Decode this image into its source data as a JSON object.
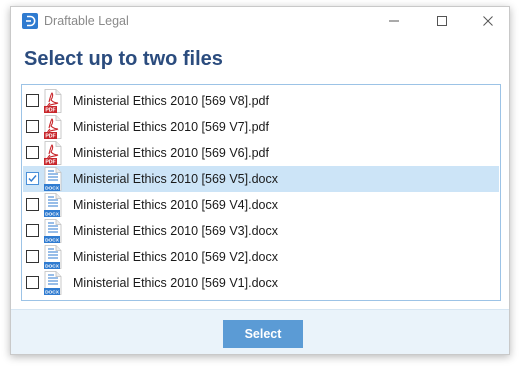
{
  "window": {
    "title": "Draftable Legal",
    "controls": {
      "minimize_icon": "minimize-icon",
      "maximize_icon": "maximize-icon",
      "close_icon": "close-icon"
    }
  },
  "heading": "Select up to two files",
  "files": [
    {
      "name": "Ministerial Ethics 2010 [569 V8].pdf",
      "type": "pdf",
      "checked": false,
      "selected": false
    },
    {
      "name": "Ministerial Ethics 2010 [569 V7].pdf",
      "type": "pdf",
      "checked": false,
      "selected": false
    },
    {
      "name": "Ministerial Ethics 2010 [569 V6].pdf",
      "type": "pdf",
      "checked": false,
      "selected": false
    },
    {
      "name": "Ministerial Ethics 2010 [569 V5].docx",
      "type": "docx",
      "checked": true,
      "selected": true
    },
    {
      "name": "Ministerial Ethics 2010 [569 V4].docx",
      "type": "docx",
      "checked": false,
      "selected": false
    },
    {
      "name": "Ministerial Ethics 2010 [569 V3].docx",
      "type": "docx",
      "checked": false,
      "selected": false
    },
    {
      "name": "Ministerial Ethics 2010 [569 V2].docx",
      "type": "docx",
      "checked": false,
      "selected": false
    },
    {
      "name": "Ministerial Ethics 2010 [569 V1].docx",
      "type": "docx",
      "checked": false,
      "selected": false
    }
  ],
  "icon_labels": {
    "pdf": "PDF",
    "docx": "DOCX"
  },
  "footer": {
    "select_label": "Select"
  },
  "colors": {
    "accent": "#5b9bd5",
    "heading": "#2b4c7e",
    "selected_row": "#cce4f7",
    "pdf_red": "#c8262b",
    "docx_blue": "#2f7bd0"
  }
}
